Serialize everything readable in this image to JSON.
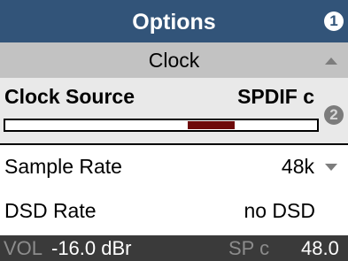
{
  "header": {
    "title": "Options",
    "badge": "1"
  },
  "section": {
    "title": "Clock"
  },
  "selected_item": {
    "label": "Clock Source",
    "value": "SPDIF c",
    "badge": "2",
    "slider_fraction": 0.15
  },
  "items": [
    {
      "label": "Sample Rate",
      "value": "48k"
    },
    {
      "label": "DSD Rate",
      "value": "no DSD"
    }
  ],
  "status_bar": {
    "vol_label": "VOL",
    "vol_value": "-16.0 dBr",
    "source_label": "SP c",
    "rate_value": "48.0"
  },
  "icons": {
    "scroll_up": "triangle-up-icon",
    "dropdown": "triangle-down-icon"
  },
  "colors": {
    "title_bar": "#325479",
    "section_bar": "#c2c2c2",
    "selected_row": "#e9e9e9",
    "slider_fill": "#6e0a0a",
    "status_bar": "#3a3a3a"
  }
}
